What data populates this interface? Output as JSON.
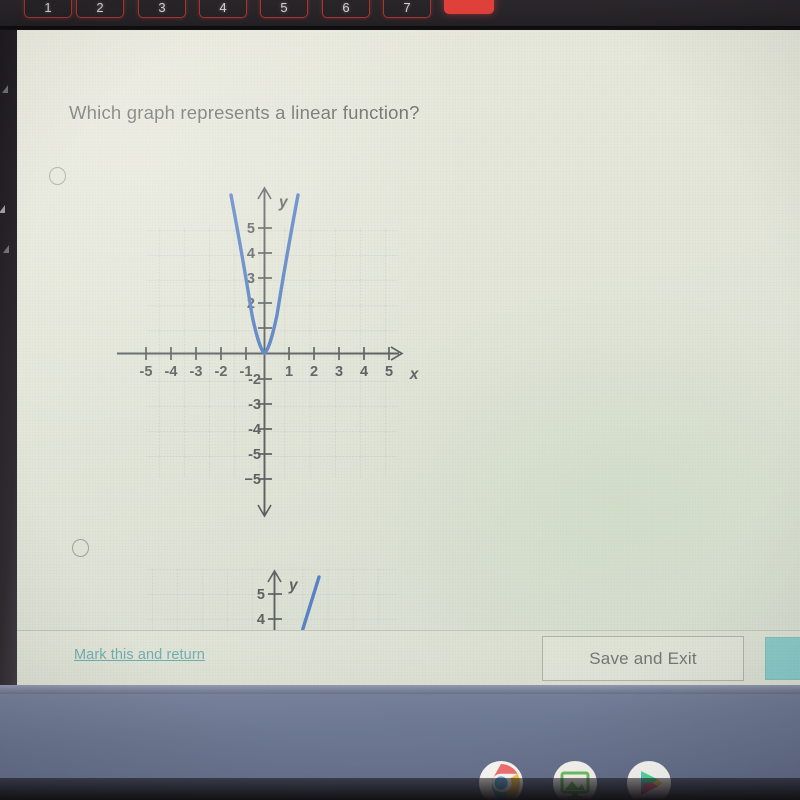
{
  "device": {
    "keyboard": {
      "key_labels": [
        "1",
        "2",
        "3",
        "4",
        "5",
        "6",
        "7"
      ],
      "backlight_color": "#dc3c37",
      "power_key_color": "#e0403a"
    },
    "shelf": {
      "background_color": "#6d7892",
      "icons": [
        {
          "name": "chrome-icon",
          "label": "Chrome"
        },
        {
          "name": "gallery-icon",
          "label": "Gallery"
        },
        {
          "name": "play-store-icon",
          "label": "Play Store"
        }
      ]
    }
  },
  "page": {
    "background_color": "#e6e8dc",
    "question": "Which graph represents a linear function?",
    "answer_options": [
      {
        "id": "option-a",
        "selected": false,
        "graph": "parabola-graph"
      },
      {
        "id": "option-b",
        "selected": false,
        "graph": "line-graph"
      }
    ]
  },
  "action_bar": {
    "mark_link_label": "Mark this and return",
    "mark_link_color": "#4aa0a6",
    "save_exit_label": "Save and Exit",
    "next_button_color": "#65c3c8"
  },
  "chart_data": [
    {
      "id": "parabola-graph",
      "type": "line",
      "title": "",
      "xlabel": "x",
      "ylabel": "y",
      "xlim": [
        -5,
        5
      ],
      "ylim": [
        -5,
        5
      ],
      "xticks": [
        -5,
        -4,
        -3,
        -2,
        -1,
        1,
        2,
        3,
        4,
        5
      ],
      "yticks": [
        -5,
        -4,
        -3,
        -2,
        -1,
        2,
        3,
        4,
        5
      ],
      "xtick_labels": [
        "-5",
        "-4",
        "-3",
        "-2",
        "-1",
        "1",
        "2",
        "3",
        "4",
        "5"
      ],
      "ytick_labels": [
        "-5",
        "-4",
        "-3",
        "-2",
        "2",
        "3",
        "4",
        "5"
      ],
      "grid": true,
      "curve_color": "#2b62c4",
      "function": "y = 3.5x^2",
      "points": [
        {
          "x": -1.34,
          "y": 6.3
        },
        {
          "x": -1.2,
          "y": 5.0
        },
        {
          "x": -1.07,
          "y": 4.0
        },
        {
          "x": -0.93,
          "y": 3.0
        },
        {
          "x": -0.76,
          "y": 2.0
        },
        {
          "x": -0.53,
          "y": 1.0
        },
        {
          "x": -0.27,
          "y": 0.25
        },
        {
          "x": 0,
          "y": 0
        },
        {
          "x": 0.27,
          "y": 0.25
        },
        {
          "x": 0.53,
          "y": 1.0
        },
        {
          "x": 0.76,
          "y": 2.0
        },
        {
          "x": 0.93,
          "y": 3.0
        },
        {
          "x": 1.07,
          "y": 4.0
        },
        {
          "x": 1.2,
          "y": 5.0
        },
        {
          "x": 1.34,
          "y": 6.3
        }
      ]
    },
    {
      "id": "line-graph",
      "type": "line",
      "title": "",
      "xlabel": "",
      "ylabel": "y",
      "xlim": [
        -5,
        5
      ],
      "ylim": [
        3,
        6.5
      ],
      "yticks": [
        4,
        5
      ],
      "ytick_labels": [
        "4",
        "5"
      ],
      "grid": true,
      "curve_color": "#2b62c4",
      "function": "steep increasing line",
      "points": [
        {
          "x": 0.55,
          "y": 3.2
        },
        {
          "x": 1.1,
          "y": 6.4
        }
      ],
      "note": "partially cut off below the visible area"
    }
  ]
}
